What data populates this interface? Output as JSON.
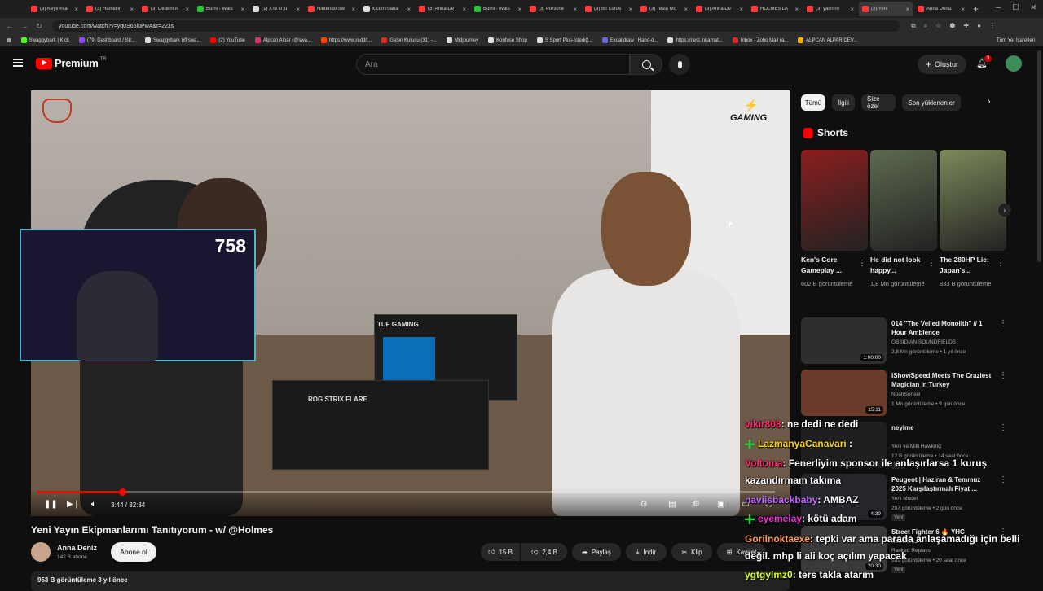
{
  "browser": {
    "tabs": [
      {
        "label": "(3) Keyfi #sal",
        "color": "#ff3b3b"
      },
      {
        "label": "(3) Hamid'in",
        "color": "#ff3b3b"
      },
      {
        "label": "(3) Dedem A",
        "color": "#ff3b3b"
      },
      {
        "label": "Burhi - Wats",
        "color": "#2fbf3b"
      },
      {
        "label": "(1) X'te lil ju",
        "color": "#dddddd"
      },
      {
        "label": "Nintendo Sw",
        "color": "#ff3b3b"
      },
      {
        "label": "x.com/Saha",
        "color": "#dddddd"
      },
      {
        "label": "(3) Anna De",
        "color": "#ff3b3b"
      },
      {
        "label": "Burhi - Wats",
        "color": "#2fbf3b"
      },
      {
        "label": "(3) Porsche",
        "color": "#ff3b3b"
      },
      {
        "label": "(3) Bir Lorde",
        "color": "#ff3b3b"
      },
      {
        "label": "(3) Tesla Mo",
        "color": "#ff3b3b"
      },
      {
        "label": "(3) Anna De",
        "color": "#ff3b3b"
      },
      {
        "label": "HOLMES'LA",
        "color": "#ff3b3b"
      },
      {
        "label": "(3) yarrrrrrr",
        "color": "#ff3b3b"
      },
      {
        "label": "(3) Yeni",
        "color": "#ff3b3b",
        "active": true
      },
      {
        "label": "Anna Deniz",
        "color": "#ff3b3b"
      }
    ],
    "url": "youtube.com/watch?v=yq0S65luPwA&t=223s",
    "bookmarks": [
      {
        "label": "Swaggybark | Kick",
        "color": "#53fc18"
      },
      {
        "label": "(79) Dashboard / Str...",
        "color": "#9146ff"
      },
      {
        "label": "Swaggybark (@swa...",
        "color": "#dddddd"
      },
      {
        "label": "(2) YouTube",
        "color": "#ff0000"
      },
      {
        "label": "Alpcan Alpar (@swa...",
        "color": "#e1306c"
      },
      {
        "label": "https://www.reddit...",
        "color": "#ff4500"
      },
      {
        "label": "Gelen Kutusu (31) -...",
        "color": "#d93025"
      },
      {
        "label": "Midjourney",
        "color": "#dddddd"
      },
      {
        "label": "Konfuse Shop",
        "color": "#dddddd"
      },
      {
        "label": "S Sport Plus-İstediğ...",
        "color": "#dddddd"
      },
      {
        "label": "Excalidraw | Hand-d...",
        "color": "#6965db"
      },
      {
        "label": "https://nest.inkarnat...",
        "color": "#dddddd"
      },
      {
        "label": "Inbox - Zoho Mail (a...",
        "color": "#e42527"
      },
      {
        "label": "ALPCAN ALPAR DEV...",
        "color": "#f4b400"
      }
    ],
    "all_bookmarks": "Tüm Yer İşaretleri"
  },
  "header": {
    "brand": "Premium",
    "country": "TR",
    "search_placeholder": "Ara",
    "create_label": "Oluştur",
    "notification_count": "3"
  },
  "player": {
    "overlay_logo_right": "GAMING",
    "gpu_box_label": "TUF GAMING",
    "keyboard_box_label": "ROG STRIX FLARE",
    "time": "3:44 / 32:34",
    "progress": 0.1146,
    "webcam_counter": "758"
  },
  "video": {
    "title": "Yeni Yayın Ekipmanlarımı Tanıtıyorum - w/ @Holmes",
    "channel": "Anna Deniz",
    "subscribers": "142 B abone",
    "subscribe_label": "Abone ol",
    "likes": "15 B",
    "dislikes": "2,4 B",
    "share": "Paylaş",
    "download": "İndir",
    "clip": "Klip",
    "save": "Kaydet",
    "views_line": "953 B görüntüleme  3 yıl önce"
  },
  "sidebar": {
    "chips": [
      "Tümü",
      "İlgili",
      "Size özel",
      "Son yüklenenler"
    ],
    "shorts_title": "Shorts",
    "shorts": [
      {
        "title": "Ken's Core Gameplay ...",
        "views": "602 B görüntüleme",
        "color": "#8b1e1e"
      },
      {
        "title": "He did not look happy...",
        "views": "1,8 Mn görüntüleme",
        "color": "#5d6a4f"
      },
      {
        "title": "The 280HP Lie: Japan's...",
        "views": "833 B görüntüleme",
        "color": "#7c8a5a"
      }
    ],
    "recommendations": [
      {
        "title": "014 \"The Veiled Monolith\" // 1 Hour Ambience",
        "channel": "OBSIDIAN SOUNDFIELDS",
        "meta": "2,8 Mn görüntüleme • 1 yıl önce",
        "duration": "1:00:00",
        "color": "#2e2e2e",
        "badge": ""
      },
      {
        "title": "IShowSpeed Meets The Craziest Magician In Turkey",
        "channel": "NoahSensei",
        "meta": "1 Mn görüntüleme • 9 gün önce",
        "duration": "15:11",
        "color": "#6a3a2a",
        "badge": ""
      },
      {
        "title": "neyime",
        "channel": "Yerli ve Milli Hawking",
        "meta": "12 B görüntüleme • 14 saat önce",
        "duration": "",
        "color": "#1f1f1f",
        "badge": "Yeni"
      },
      {
        "title": "Peugeot | Haziran & Temmuz 2025 Karşılaştırmalı Fiyat ...",
        "channel": "Yeni Model",
        "meta": "207 görüntüleme • 2 gün önce",
        "duration": "4:39",
        "color": "#24262c",
        "badge": "Yeni"
      },
      {
        "title": "Street Fighter 6 🔥 YHC MOCHI...",
        "channel": "Ranked Replays",
        "meta": "989 görüntüleme • 20 saat önce",
        "duration": "20:30",
        "color": "#3a3a3a",
        "badge": "Yeni"
      }
    ]
  },
  "chat": [
    {
      "user": "vikir808",
      "text": ": ne dedi ne dedi",
      "color": "#ff2b6a",
      "emote": ""
    },
    {
      "user": "LazmanyaCanavari",
      "text": " :",
      "color": "#ffd400",
      "emote": "green"
    },
    {
      "user": "Voltoma",
      "text": ": Fenerliyim sponsor ile anlaşırlarsa 1 kuruş",
      "color": "#ff2b6a",
      "emote": ""
    },
    {
      "user": "",
      "text": "kazandırmam takıma",
      "color": "#ffffff",
      "emote": ""
    },
    {
      "user": "naviisbackbaby",
      "text": ": AMBAZ",
      "color": "#c46bff",
      "emote": ""
    },
    {
      "user": "eyemelay",
      "text": ": kötü adam",
      "color": "#ff2bd6",
      "emote": "green"
    },
    {
      "user": "Gorilnoktaexe",
      "text": ": tepki var ama parada anlaşamadığı için belli",
      "color": "#ff9b5c",
      "emote": ""
    },
    {
      "user": "",
      "text": "değil. mhp li ali koç açılım yapacak",
      "color": "#ffffff",
      "emote": ""
    },
    {
      "user": "ygtgylmz0",
      "text": ": ters takla atarım",
      "color": "#d8ff2b",
      "emote": ""
    }
  ]
}
